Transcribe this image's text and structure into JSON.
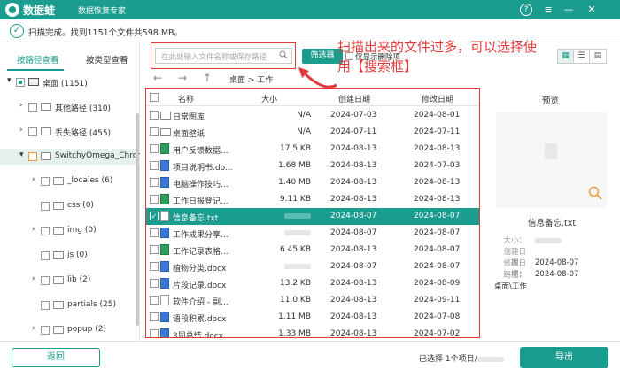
{
  "titlebar": {
    "brand": "数据蛙",
    "subtitle": "数据恢复专家",
    "help_icon": "?",
    "menu_icon": "≡",
    "minimize_icon": "—",
    "close_icon": "✕"
  },
  "status": {
    "text": "扫描完成。找到1151个文件共598 MB。"
  },
  "sidebar": {
    "tabs": [
      "按路径查看",
      "按类型查看"
    ],
    "tree": [
      {
        "label": "桌面 (1151)",
        "type": "drive",
        "arrow": "▾",
        "level": 0,
        "check": "partial"
      },
      {
        "label": "其他路径 (310)",
        "type": "folder",
        "arrow": "›",
        "level": 1,
        "check": "none"
      },
      {
        "label": "丢失路径 (455)",
        "type": "folder",
        "arrow": "›",
        "level": 1,
        "check": "none"
      },
      {
        "label": "SwitchyOmega_Chrom",
        "type": "folder",
        "arrow": "▾",
        "level": 1,
        "check": "orange",
        "selected": true
      },
      {
        "label": "_locales (6)",
        "type": "folder",
        "arrow": "›",
        "level": 2,
        "check": "none"
      },
      {
        "label": "css (0)",
        "type": "folder",
        "arrow": "",
        "level": 2,
        "check": "none"
      },
      {
        "label": "img (0)",
        "type": "folder",
        "arrow": "›",
        "level": 2,
        "check": "none"
      },
      {
        "label": "js (0)",
        "type": "folder",
        "arrow": "",
        "level": 2,
        "check": "none"
      },
      {
        "label": "lib (2)",
        "type": "folder",
        "arrow": "›",
        "level": 2,
        "check": "none"
      },
      {
        "label": "partials (25)",
        "type": "folder",
        "arrow": "",
        "level": 2,
        "check": "none"
      },
      {
        "label": "popup (2)",
        "type": "folder",
        "arrow": "›",
        "level": 2,
        "check": "none"
      }
    ]
  },
  "toolbar": {
    "search_placeholder": "在此处输入文件名称或保存路径",
    "filter_label": "筛选器",
    "show_deleted_label": "仅显示删除项",
    "annotation": "扫描出来的文件过多，可以选择使用【搜索框】"
  },
  "nav": {
    "back_icon": "←",
    "forward_icon": "→",
    "up_icon": "↑",
    "breadcrumb": "桌面 > 工作"
  },
  "table": {
    "headers": [
      "名称",
      "大小",
      "创建日期",
      "修改日期"
    ],
    "rows": [
      {
        "name": "日常图库",
        "size": "N/A",
        "created": "2024-07-03",
        "modified": "2024-08-01",
        "icon": "folder",
        "selected": false
      },
      {
        "name": "桌面壁纸",
        "size": "N/A",
        "created": "2024-07-11",
        "modified": "2024-07-11",
        "icon": "folder",
        "selected": false
      },
      {
        "name": "用户反馈数据...",
        "size": "17.5 KB",
        "created": "2024-08-13",
        "modified": "2024-08-13",
        "icon": "xls",
        "selected": false
      },
      {
        "name": "项目说明书.do...",
        "size": "1.68 MB",
        "created": "2024-08-13",
        "modified": "2024-07-03",
        "icon": "doc",
        "selected": false
      },
      {
        "name": "电脑操作技巧...",
        "size": "1.40 MB",
        "created": "2024-08-13",
        "modified": "2024-08-13",
        "icon": "doc",
        "selected": false
      },
      {
        "name": "工作日报登记...",
        "size": "9.11 KB",
        "created": "2024-08-13",
        "modified": "2024-08-13",
        "icon": "xls",
        "selected": false
      },
      {
        "name": "信息备忘.txt",
        "size": "",
        "created": "2024-08-07",
        "modified": "2024-08-07",
        "icon": "txt",
        "selected": true
      },
      {
        "name": "工作成果分享...",
        "size": "",
        "created": "2024-08-07",
        "modified": "2024-08-07",
        "icon": "doc",
        "selected": false
      },
      {
        "name": "工作记录表格...",
        "size": "6.45 KB",
        "created": "2024-08-13",
        "modified": "2024-08-07",
        "icon": "xls",
        "selected": false
      },
      {
        "name": "植物分类.docx",
        "size": "",
        "created": "2024-08-07",
        "modified": "2024-08-07",
        "icon": "doc",
        "selected": false
      },
      {
        "name": "片段记录.docx",
        "size": "13.2 KB",
        "created": "2024-08-13",
        "modified": "2024-08-09",
        "icon": "doc",
        "selected": false
      },
      {
        "name": "软件介绍 - 副...",
        "size": "11.0 KB",
        "created": "2024-08-13",
        "modified": "2024-09-11",
        "icon": "txt",
        "selected": false
      },
      {
        "name": "语段积累.docx",
        "size": "1.11 MB",
        "created": "2024-08-13",
        "modified": "2024-07-08",
        "icon": "doc",
        "selected": false
      },
      {
        "name": "3周总结.docx",
        "size": "1.33 MB",
        "created": "2024-08-13",
        "modified": "2024-07-02",
        "icon": "doc",
        "selected": false
      }
    ]
  },
  "preview": {
    "title": "预览",
    "file_name": "信息备忘.txt",
    "labels": {
      "size": "大小：",
      "created": "创建日期：",
      "modified": "修改日期：",
      "path": "路径："
    },
    "created": "2024-08-07",
    "modified": "2024-08-07",
    "path": "桌面\\工作"
  },
  "footer": {
    "back_label": "返回",
    "selection_info": "已选择 1个项目/",
    "export_label": "导出"
  },
  "colors": {
    "accent": "#1a9c8e",
    "annotation_red": "#e23a3a"
  }
}
